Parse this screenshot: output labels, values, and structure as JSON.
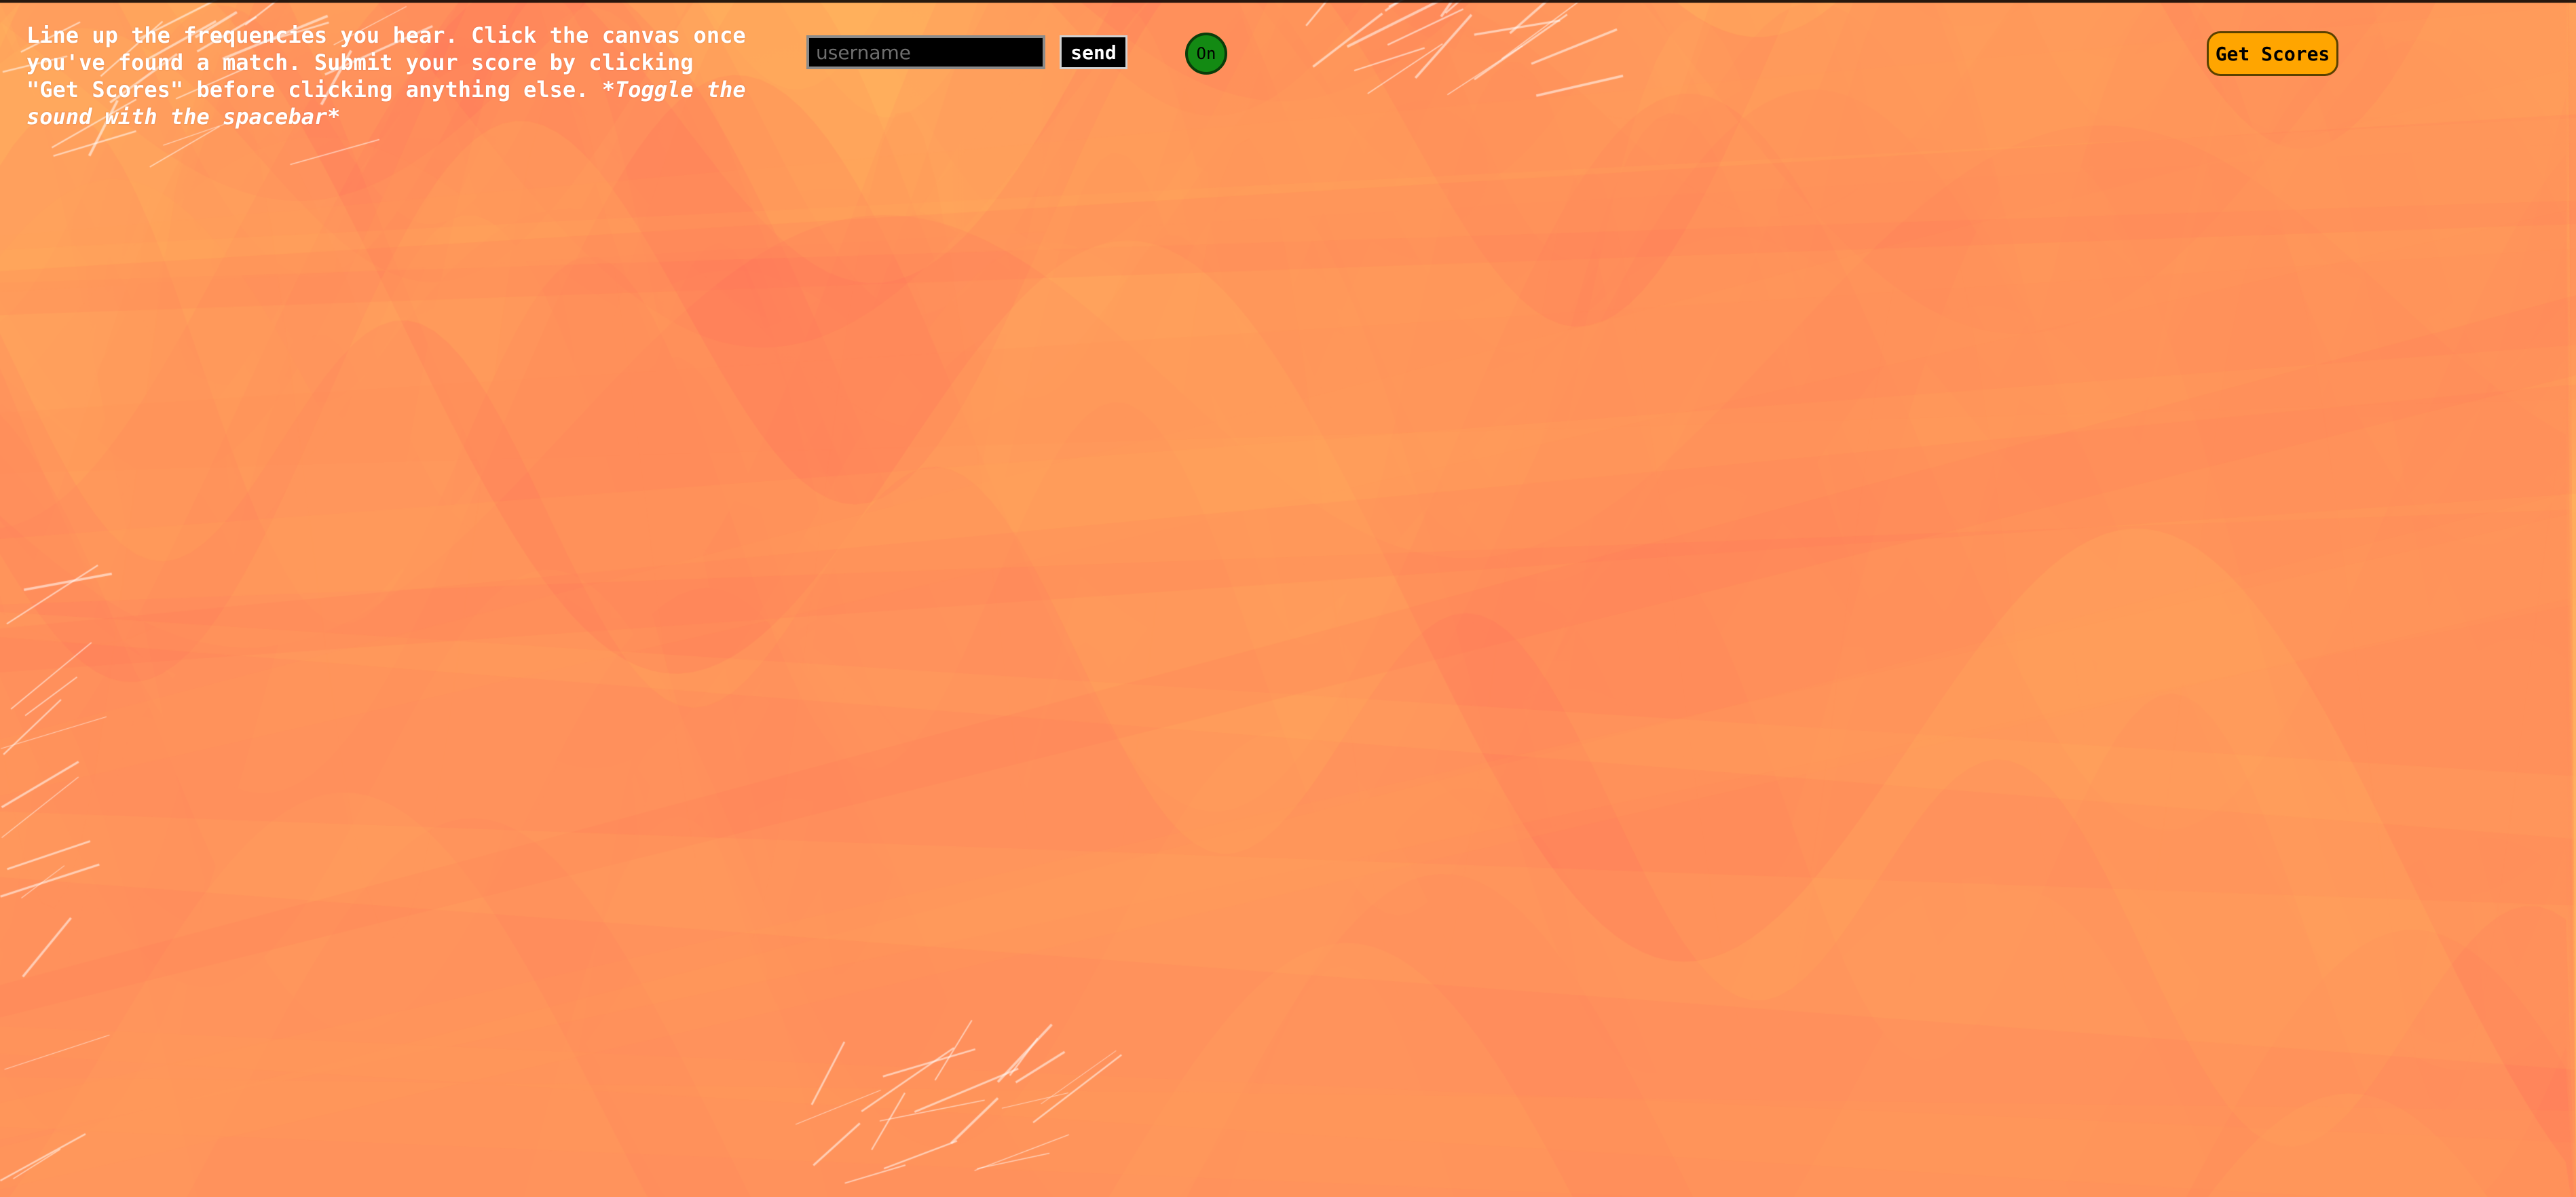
{
  "instructions": {
    "text": "Line up the frequencies you hear. Click the canvas once you've found a match. Submit your score by clicking \"Get Scores\" before clicking anything else. ",
    "italic": "*Toggle the sound with the spacebar*"
  },
  "score_form": {
    "username_placeholder": "username",
    "username_value": "",
    "send_label": "send"
  },
  "sound_toggle": {
    "label": "On",
    "color": "#138a13"
  },
  "get_scores": {
    "label": "Get Scores",
    "color": "#ffa500"
  },
  "canvas": {
    "palette": [
      "#ffb45c",
      "#ffa25e",
      "#ff8a5c",
      "#ff6e5e",
      "#ff4f5e",
      "#ffc060"
    ],
    "background": "#ffad5c"
  }
}
